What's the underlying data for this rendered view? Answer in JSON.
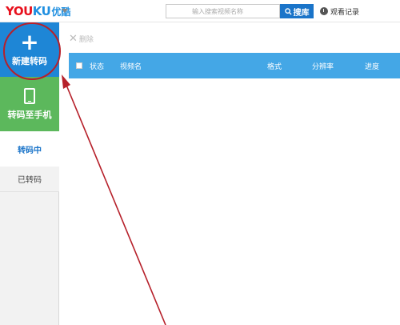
{
  "header": {
    "logo_primary_a": "YOU",
    "logo_primary_b": "KU",
    "logo_cn": "优酷",
    "search_placeholder": "输入搜索视频名称",
    "search_button": "搜库",
    "history_label": "观看记录"
  },
  "sidebar": {
    "new_transcode": "新建转码",
    "to_phone": "转码至手机",
    "in_progress": "转码中",
    "done": "已转码"
  },
  "toolbar": {
    "delete_label": "删除"
  },
  "table": {
    "columns": [
      "状态",
      "视频名",
      "格式",
      "分辨率",
      "进度"
    ]
  },
  "colors": {
    "accent_blue": "#1e86d6",
    "header_blue": "#44a7e6",
    "green": "#5cb85c",
    "annotation_red": "#b6202a"
  }
}
